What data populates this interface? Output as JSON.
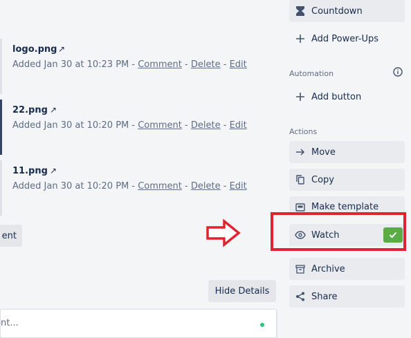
{
  "attachments": [
    {
      "name": "logo.png",
      "ext_icon": "↗",
      "added": "Added Jan 30 at 10:23 PM - ",
      "comment": "Comment",
      "sep1": " - ",
      "delete": "Delete",
      "sep2": " - ",
      "edit": "Edit"
    },
    {
      "name": "22.png",
      "ext_icon": "↗",
      "added": "Added Jan 30 at 10:20 PM - ",
      "comment": "Comment",
      "sep1": " - ",
      "delete": "Delete",
      "sep2": " - ",
      "edit": "Edit"
    },
    {
      "name": "11.png",
      "ext_icon": "↗",
      "added": "Added Jan 30 at 10:20 PM - ",
      "comment": "Comment",
      "sep1": " - ",
      "delete": "Delete",
      "sep2": " - ",
      "edit": "Edit"
    }
  ],
  "partial_button_label": "ent",
  "hide_details_label": "Hide Details",
  "comment_placeholder": "nt...",
  "sidebar": {
    "countdown_label": "Countdown",
    "add_powerups_label": "Add Power-Ups",
    "automation_heading": "Automation",
    "add_button_label": "Add button",
    "actions_heading": "Actions",
    "move_label": "Move",
    "copy_label": "Copy",
    "make_template_label": "Make template",
    "watch_label": "Watch",
    "archive_label": "Archive",
    "share_label": "Share"
  },
  "colors": {
    "annotation_red": "#e0242f",
    "watch_check_green": "#5aac44"
  }
}
